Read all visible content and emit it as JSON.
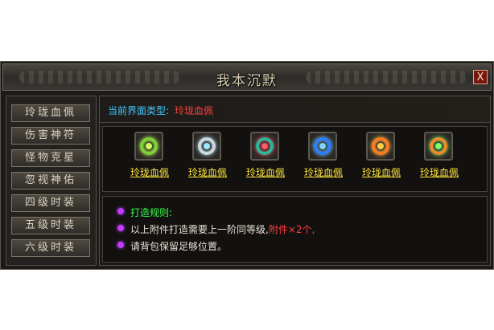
{
  "window": {
    "title": "我本沉默",
    "close_label": "X"
  },
  "sidebar": {
    "items": [
      {
        "label": "玲珑血佩"
      },
      {
        "label": "伤害神符"
      },
      {
        "label": "怪物克星"
      },
      {
        "label": "忽视神佑"
      },
      {
        "label": "四级时装"
      },
      {
        "label": "五级时装"
      },
      {
        "label": "六级时装"
      }
    ]
  },
  "main": {
    "type_label": "当前界面类型:",
    "type_value": "玲珑血佩",
    "items": [
      {
        "name": "玲珑血佩",
        "icon": "ring-green-icon",
        "color": "#7fd03a",
        "glow": "#c8ff5a"
      },
      {
        "name": "玲珑血佩",
        "icon": "ring-white-icon",
        "color": "#cfd8d8",
        "glow": "#9fe8ff"
      },
      {
        "name": "玲珑血佩",
        "icon": "ring-teal-icon",
        "color": "#2fb59a",
        "glow": "#ff5a6a"
      },
      {
        "name": "玲珑血佩",
        "icon": "ring-blue-icon",
        "color": "#2f7dff",
        "glow": "#7fd8ff"
      },
      {
        "name": "玲珑血佩",
        "icon": "ring-orange-icon",
        "color": "#ff7a22",
        "glow": "#ffd04a"
      },
      {
        "name": "玲珑血佩",
        "icon": "ring-orange-green-icon",
        "color": "#f08a2a",
        "glow": "#7fff6a"
      }
    ],
    "rules": {
      "heading": "打造规则:",
      "line1_text": "以上附件打造需要上一阶同等级,",
      "line1_highlight": "附件×2个,",
      "line2": "请背包保留足够位置。"
    }
  }
}
